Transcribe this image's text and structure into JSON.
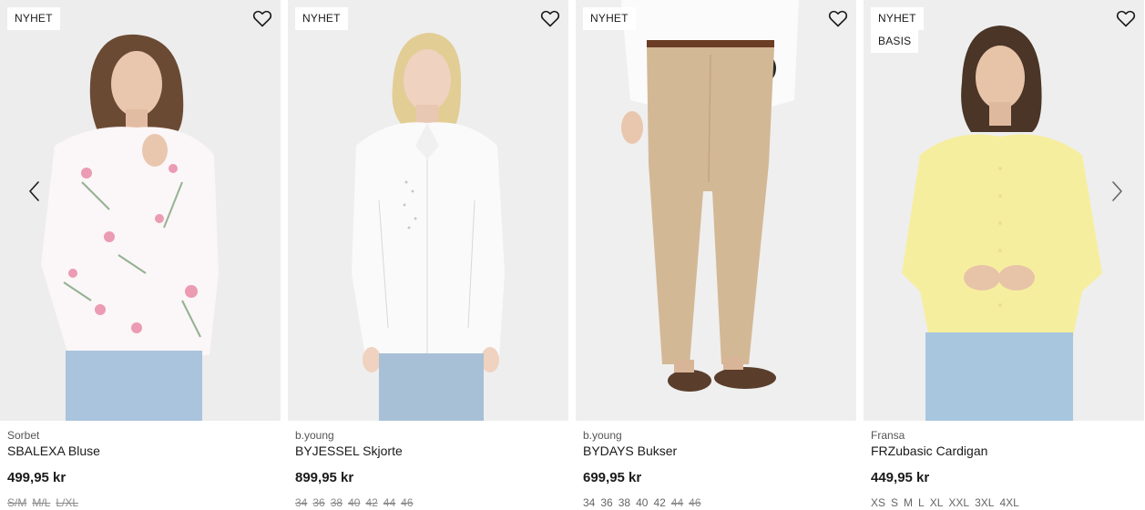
{
  "carousel": {
    "products": [
      {
        "badges": [
          "NYHET"
        ],
        "brand": "Sorbet",
        "name": "SBALEXA Bluse",
        "price": "499,95 kr",
        "sizes": [
          {
            "label": "S/M",
            "available": false
          },
          {
            "label": "M/L",
            "available": false
          },
          {
            "label": "L/XL",
            "available": false
          }
        ]
      },
      {
        "badges": [
          "NYHET"
        ],
        "brand": "b.young",
        "name": "BYJESSEL Skjorte",
        "price": "899,95 kr",
        "sizes": [
          {
            "label": "34",
            "available": false
          },
          {
            "label": "36",
            "available": false
          },
          {
            "label": "38",
            "available": false
          },
          {
            "label": "40",
            "available": false
          },
          {
            "label": "42",
            "available": false
          },
          {
            "label": "44",
            "available": false
          },
          {
            "label": "46",
            "available": false
          }
        ]
      },
      {
        "badges": [
          "NYHET"
        ],
        "brand": "b.young",
        "name": "BYDAYS Bukser",
        "price": "699,95 kr",
        "sizes": [
          {
            "label": "34",
            "available": true
          },
          {
            "label": "36",
            "available": true
          },
          {
            "label": "38",
            "available": true
          },
          {
            "label": "40",
            "available": true
          },
          {
            "label": "42",
            "available": true
          },
          {
            "label": "44",
            "available": false
          },
          {
            "label": "46",
            "available": false
          }
        ]
      },
      {
        "badges": [
          "NYHET",
          "BASIS"
        ],
        "brand": "Fransa",
        "name": "FRZubasic Cardigan",
        "price": "449,95 kr",
        "sizes": [
          {
            "label": "XS",
            "available": true
          },
          {
            "label": "S",
            "available": true
          },
          {
            "label": "M",
            "available": true
          },
          {
            "label": "L",
            "available": true
          },
          {
            "label": "XL",
            "available": true
          },
          {
            "label": "XXL",
            "available": true
          },
          {
            "label": "3XL",
            "available": true
          },
          {
            "label": "4XL",
            "available": true
          }
        ]
      }
    ]
  },
  "icons": {
    "favorite": "heart-outline-icon",
    "prev": "chevron-left-icon",
    "next": "chevron-right-icon"
  },
  "colors": {
    "text": "#1a1a1a",
    "image_bg": "#eeeeee",
    "muted": "#666666"
  }
}
